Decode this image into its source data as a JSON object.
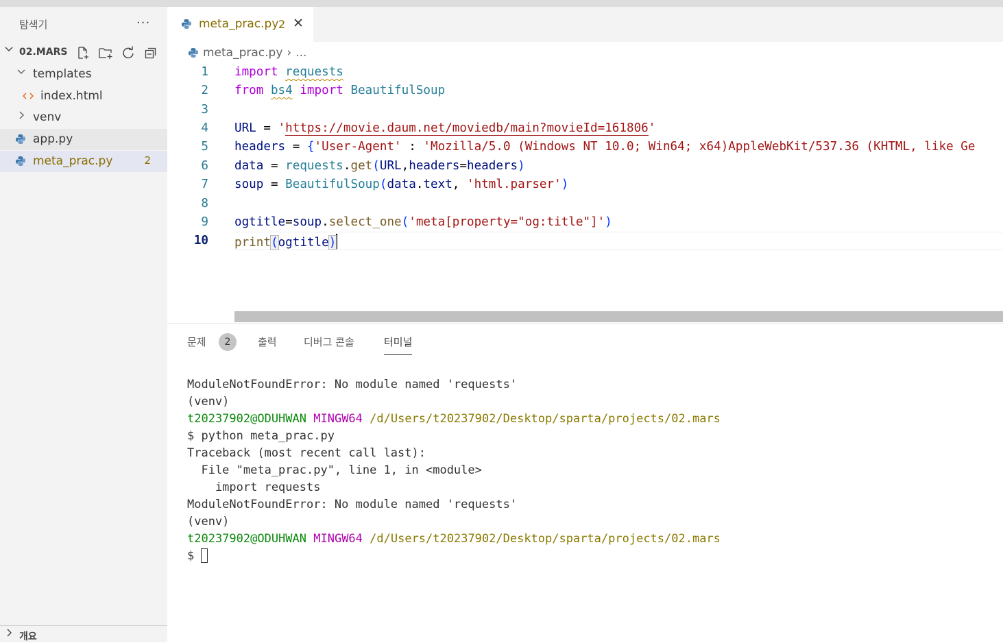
{
  "explorer": {
    "title": "탐색기",
    "more": "···",
    "folder": "02.MARS",
    "items": [
      {
        "label": "templates"
      },
      {
        "label": "index.html"
      },
      {
        "label": "venv"
      },
      {
        "label": "app.py"
      },
      {
        "label": "meta_prac.py",
        "badge": "2"
      }
    ],
    "outline": "개요"
  },
  "tab": {
    "label": "meta_prac.py",
    "problems": "2",
    "close": "✕"
  },
  "breadcrumb": {
    "file": "meta_prac.py",
    "sep": "›",
    "more": "..."
  },
  "editor": {
    "line_numbers": [
      "1",
      "2",
      "3",
      "4",
      "5",
      "6",
      "7",
      "8",
      "9",
      "10"
    ],
    "lines": [
      [
        "import",
        "requests"
      ],
      [
        "from",
        "bs4",
        "import",
        "BeautifulSoup"
      ],
      [],
      [
        "URL",
        " = ",
        "'",
        "https://movie.daum.net/moviedb/main?movieId=161806",
        "'"
      ],
      [
        "headers",
        " = ",
        "{",
        "'User-Agent'",
        " : ",
        "'Mozilla/5.0 (Windows NT 10.0; Win64; x64)AppleWebKit/537.36 (KHTML, like Ge"
      ],
      [
        "data",
        " = ",
        "requests",
        ".",
        "get",
        "(",
        "URL",
        ",",
        "headers",
        "=",
        "headers",
        ")"
      ],
      [
        "soup",
        " = ",
        "BeautifulSoup",
        "(",
        "data",
        ".",
        "text",
        ", ",
        "'html.parser'",
        ")"
      ],
      [],
      [
        "ogtitle",
        "=",
        "soup",
        ".",
        "select_one",
        "(",
        "'meta[property=\"og:title\"]'",
        ")"
      ],
      [
        "print",
        "(",
        "ogtitle",
        ")"
      ]
    ]
  },
  "panel": {
    "tabs": {
      "problems": "문제",
      "problems_count": "2",
      "output": "출력",
      "debug": "디버그 콘솔",
      "terminal": "터미널"
    },
    "terminal_lines": {
      "l1": "ModuleNotFoundError: No module named 'requests'",
      "l2": "(venv)",
      "user": "t20237902@ODUHWAN",
      "sys": "MINGW64",
      "path": "/d/Users/t20237902/Desktop/sparta/projects/02.mars",
      "l4": "$ python meta_prac.py",
      "l5": "Traceback (most recent call last):",
      "l6": "  File \"meta_prac.py\", line 1, in <module>",
      "l7": "    import requests",
      "l8": "ModuleNotFoundError: No module named 'requests'",
      "l9": "(venv)",
      "prompt": "$ "
    }
  },
  "colors": {
    "keyword": "#af00db",
    "string": "#a31515",
    "class": "#267f99",
    "variable": "#001080",
    "function": "#795e26",
    "warning": "#8a6d00"
  }
}
